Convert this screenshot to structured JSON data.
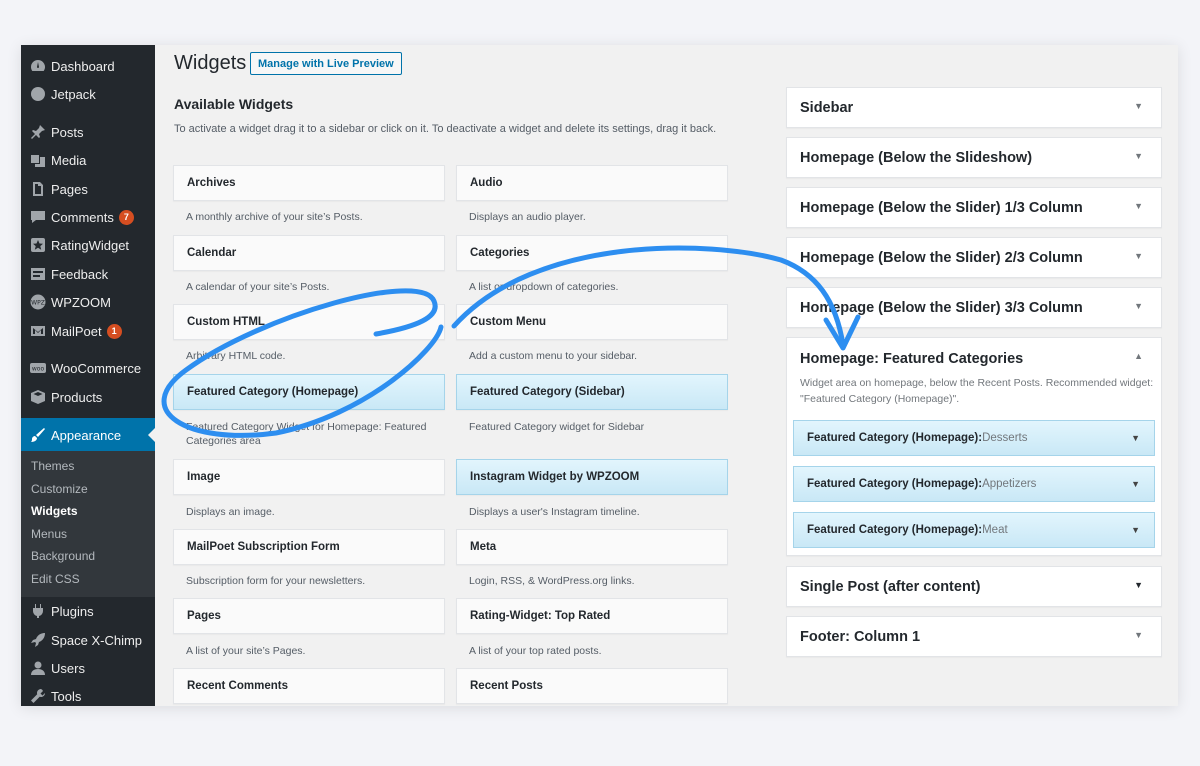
{
  "menu": {
    "items": [
      {
        "label": "Dashboard",
        "icon": "dashboard-icon"
      },
      {
        "label": "Jetpack",
        "icon": "jetpack-icon"
      },
      {
        "label": "Posts",
        "icon": "pin-icon"
      },
      {
        "label": "Media",
        "icon": "media-icon"
      },
      {
        "label": "Pages",
        "icon": "page-icon"
      },
      {
        "label": "Comments",
        "icon": "comment-icon",
        "badge": "7"
      },
      {
        "label": "RatingWidget",
        "icon": "star-icon"
      },
      {
        "label": "Feedback",
        "icon": "feedback-icon"
      },
      {
        "label": "WPZOOM",
        "icon": "wpzoom-icon"
      },
      {
        "label": "MailPoet",
        "icon": "mailpoet-icon",
        "badge": "1"
      },
      {
        "label": "WooCommerce",
        "icon": "woocommerce-icon"
      },
      {
        "label": "Products",
        "icon": "box-icon"
      },
      {
        "label": "Appearance",
        "icon": "brush-icon"
      },
      {
        "label": "Plugins",
        "icon": "plug-icon"
      },
      {
        "label": "Space X-Chimp",
        "icon": "rocket-icon"
      },
      {
        "label": "Users",
        "icon": "user-icon"
      },
      {
        "label": "Tools",
        "icon": "wrench-icon"
      }
    ],
    "submenu": [
      "Themes",
      "Customize",
      "Widgets",
      "Menus",
      "Background",
      "Edit CSS"
    ]
  },
  "header": {
    "title": "Widgets",
    "live_preview_label": "Manage with Live Preview"
  },
  "available": {
    "title": "Available Widgets",
    "description": "To activate a widget drag it to a sidebar or click on it. To deactivate a widget and delete its settings, drag it back.",
    "widgets": [
      {
        "name": "Archives",
        "desc": "A monthly archive of your site’s Posts."
      },
      {
        "name": "Audio",
        "desc": "Displays an audio player."
      },
      {
        "name": "Calendar",
        "desc": "A calendar of your site’s Posts."
      },
      {
        "name": "Categories",
        "desc": "A list or dropdown of categories."
      },
      {
        "name": "Custom HTML",
        "desc": "Arbitrary HTML code."
      },
      {
        "name": "Custom Menu",
        "desc": "Add a custom menu to your sidebar."
      },
      {
        "name": "Featured Category (Homepage)",
        "desc": "Featured Category Widget for Homepage: Featured Categories area"
      },
      {
        "name": "Featured Category (Sidebar)",
        "desc": "Featured Category widget for Sidebar"
      },
      {
        "name": "Image",
        "desc": "Displays an image."
      },
      {
        "name": "Instagram Widget by WPZOOM",
        "desc": "Displays a user's Instagram timeline."
      },
      {
        "name": "MailPoet Subscription Form",
        "desc": "Subscription form for your newsletters."
      },
      {
        "name": "Meta",
        "desc": "Login, RSS, & WordPress.org links."
      },
      {
        "name": "Pages",
        "desc": "A list of your site’s Pages."
      },
      {
        "name": "Rating-Widget: Top Rated",
        "desc": "A list of your top rated posts."
      },
      {
        "name": "Recent Comments",
        "desc": ""
      },
      {
        "name": "Recent Posts",
        "desc": ""
      }
    ]
  },
  "sidebars": [
    {
      "title": "Sidebar"
    },
    {
      "title": "Homepage (Below the Slideshow)"
    },
    {
      "title": "Homepage (Below the Slider) 1/3 Column"
    },
    {
      "title": "Homepage (Below the Slider) 2/3 Column"
    },
    {
      "title": "Homepage (Below the Slider) 3/3 Column"
    },
    {
      "title": "Homepage: Featured Categories"
    },
    {
      "title": "Single Post (after content)"
    },
    {
      "title": "Footer: Column 1"
    }
  ],
  "featured_area": {
    "description": "Widget area on homepage, below the Recent Posts. Recommended widget: \"Featured Category (Homepage)\".",
    "widgets": [
      {
        "name": "Featured Category (Homepage):",
        "value": " Desserts"
      },
      {
        "name": "Featured Category (Homepage):",
        "value": " Appetizers"
      },
      {
        "name": "Featured Category (Homepage):",
        "value": " Meat"
      }
    ]
  },
  "colors": {
    "accent": "#0073aa",
    "annotation": "#2d8ef0",
    "menu_bg": "#23282d",
    "badge": "#d54e21"
  }
}
